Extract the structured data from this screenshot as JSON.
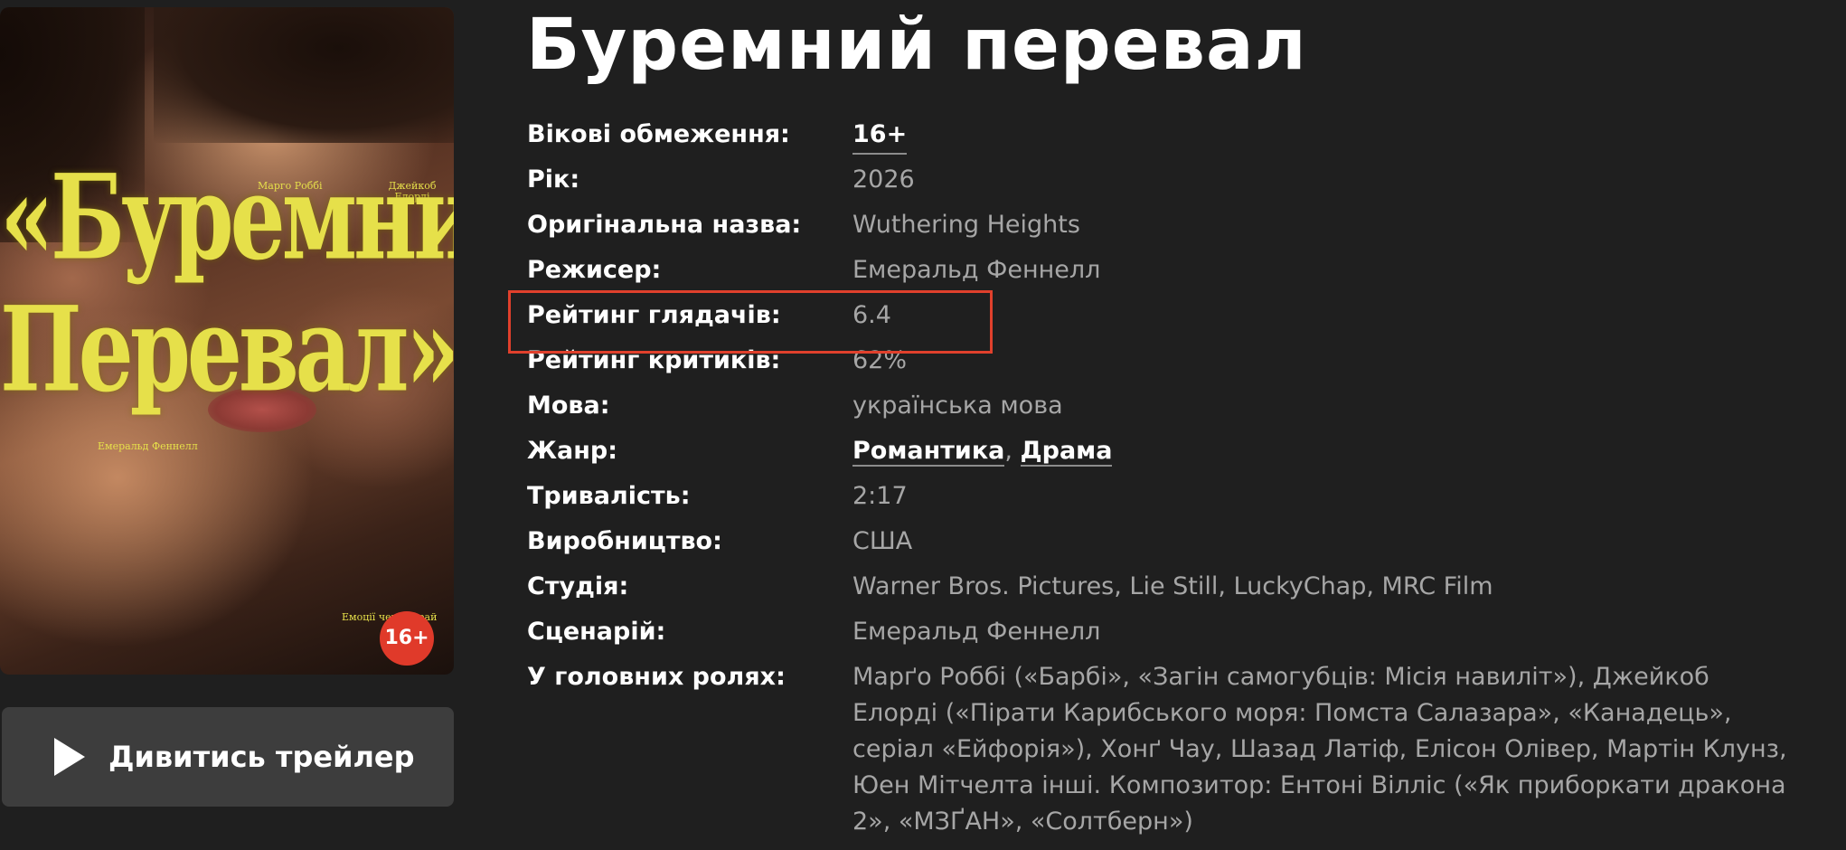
{
  "movie": {
    "title": "Буремний перевал",
    "poster": {
      "title_line1": "«Буремний",
      "title_line2": "Перевал»",
      "credit_left": "Марго Роббі",
      "credit_right": "Джейкоб Елорді",
      "director_credit": "Емеральд Феннелл",
      "age_badge": "16+",
      "bottom_text": "Емоції через край"
    },
    "trailer_button": {
      "label": "Дивитись трейлер",
      "icon": "play-icon"
    },
    "details": {
      "age_label": "Вікові обмеження:",
      "age_value": "16+",
      "year_label": "Рік:",
      "year_value": "2026",
      "original_title_label": "Оригінальна назва:",
      "original_title_value": "Wuthering Heights",
      "director_label": "Режисер:",
      "director_value": "Емеральд Феннелл",
      "audience_rating_label": "Рейтинг глядачів:",
      "audience_rating_value": "6.4",
      "critics_rating_label": "Рейтинг критиків:",
      "critics_rating_value": "62%",
      "language_label": "Мова:",
      "language_value": "українська мова",
      "genre_label": "Жанр:",
      "genres": [
        "Романтика",
        "Драма"
      ],
      "genre_separator": ", ",
      "duration_label": "Тривалість:",
      "duration_value": "2:17",
      "production_label": "Виробництво:",
      "production_value": "США",
      "studio_label": "Студія:",
      "studio_value": "Warner Bros. Pictures, Lie Still, LuckyChap, MRC Film",
      "screenplay_label": "Сценарій:",
      "screenplay_value": "Емеральд Феннелл",
      "cast_label": "У головних ролях:",
      "cast_value": "Марґо Роббі («Барбі», «Загін самогубців: Місія навиліт»), Джейкоб Елорді («Пірати Карибського моря: Помста Салазара», «Канадець», серіал «Ейфорія»), Хонґ Чау, Шазад Латіф, Елісон Олівер, Мартін Клунз, Юен Мітчелта інші. Композитор: Ентоні Вілліс («Як приборкати дракона 2», «МЗҐАН», «Солтберн»)"
    }
  },
  "colors": {
    "background": "#1f1f1f",
    "label": "#ffffff",
    "value": "#a6a6a6",
    "button_bg": "#3d3d3d",
    "highlight_border": "#e0402c",
    "badge": "#e03a2a",
    "poster_title": "#e6e04a"
  }
}
